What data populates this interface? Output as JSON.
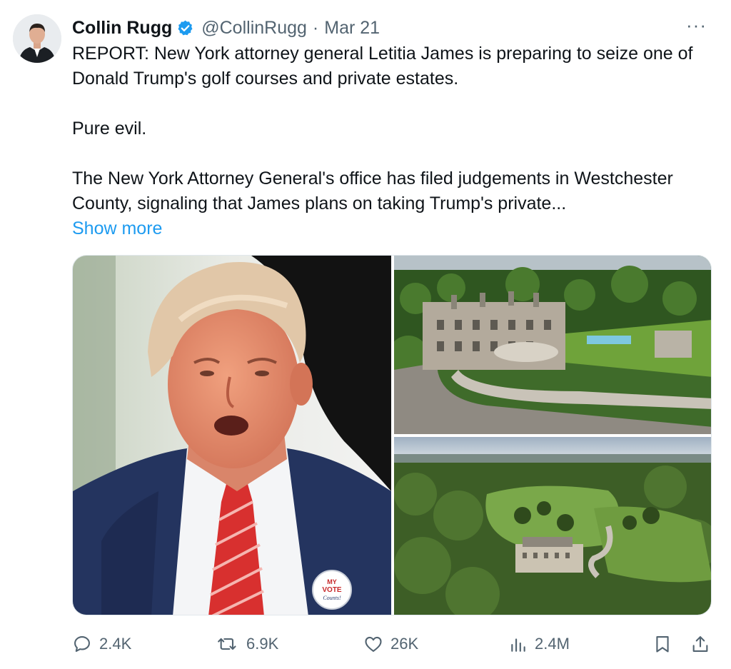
{
  "tweet": {
    "author_name": "Collin Rugg",
    "handle": "@CollinRugg",
    "separator": "·",
    "date": "Mar 21",
    "more_label": "···",
    "paragraphs": [
      "REPORT: New York attorney general Letitia James is preparing to seize one of Donald Trump's golf courses and private estates.",
      "Pure evil.",
      "The New York Attorney General's office has filed judgements in Westchester County, signaling that James plans on taking Trump's private..."
    ],
    "show_more_label": "Show more"
  },
  "media": {
    "badge_text": [
      "MY",
      "VOTE",
      "Counts!"
    ]
  },
  "actions": {
    "replies": "2.4K",
    "reposts": "6.9K",
    "likes": "26K",
    "views": "2.4M"
  },
  "colors": {
    "link": "#1d9bf0",
    "verified": "#1d9bf0",
    "secondary_text": "#536471"
  },
  "icons": [
    "verified-badge-icon",
    "more-icon",
    "reply-icon",
    "repost-icon",
    "like-icon",
    "views-icon",
    "bookmark-icon",
    "share-icon"
  ]
}
